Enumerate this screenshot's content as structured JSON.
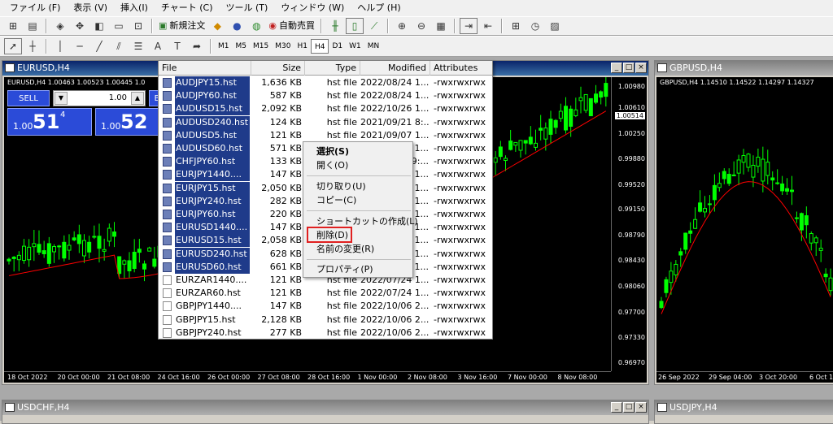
{
  "menu": [
    "ファイル (F)",
    "表示 (V)",
    "挿入(I)",
    "チャート (C)",
    "ツール (T)",
    "ウィンドウ (W)",
    "ヘルプ (H)"
  ],
  "toolbar": {
    "new_order": "新規注文",
    "auto_trading": "自動売買",
    "timeframes": [
      "M1",
      "M5",
      "M15",
      "M30",
      "H1",
      "H4",
      "D1",
      "W1",
      "MN"
    ],
    "active_timeframe": "H4"
  },
  "windows": {
    "eurusd": {
      "title": "EURUSD,H4",
      "info": "EURUSD,H4 1.00463 1.00523 1.00445 1.0",
      "sell_label": "SELL",
      "buy_label": "B",
      "lot": "1.00",
      "bid_small": "1.00",
      "bid_big": "51",
      "bid_sup": "4",
      "ask_small": "1.00",
      "ask_big": "52",
      "yaxis": [
        "1.00980",
        "1.00610",
        "1.00514",
        "1.00250",
        "0.99880",
        "0.99520",
        "0.99150",
        "0.98790",
        "0.98430",
        "0.98060",
        "0.97700",
        "0.97330",
        "0.96970"
      ],
      "current_price": "1.00514",
      "xaxis": [
        "18 Oct 2022",
        "20 Oct 00:00",
        "21 Oct 08:00",
        "24 Oct 16:00",
        "26 Oct 00:00",
        "27 Oct 08:00",
        "28 Oct 16:00",
        "1 Nov 00:00",
        "2 Nov 08:00",
        "3 Nov 16:00",
        "7 Nov 00:00",
        "8 Nov 08:00"
      ]
    },
    "gbpusd": {
      "title": "GBPUSD,H4",
      "info": "GBPUSD,H4 1.14510 1.14522 1.14297 1.14327",
      "xaxis": [
        "26 Sep 2022",
        "29 Sep 04:00",
        "3 Oct 20:00",
        "6 Oct 12"
      ]
    },
    "usdchf": {
      "title": "USDCHF,H4"
    },
    "usdjpy": {
      "title": "USDJPY,H4"
    }
  },
  "filelist": {
    "columns": [
      "File",
      "Size",
      "Type",
      "Modified",
      "Attributes"
    ],
    "rows": [
      {
        "name": "AUDJPY15.hst",
        "size": "1,636 KB",
        "type": "hst file",
        "modified": "2022/08/24 1...",
        "attr": "-rwxrwxrwx",
        "selected": true
      },
      {
        "name": "AUDJPY60.hst",
        "size": "587 KB",
        "type": "hst file",
        "modified": "2022/08/24 1...",
        "attr": "-rwxrwxrwx",
        "selected": true
      },
      {
        "name": "AUDUSD15.hst",
        "size": "2,092 KB",
        "type": "hst file",
        "modified": "2022/10/26 1...",
        "attr": "-rwxrwxrwx",
        "selected": true
      },
      {
        "name": "AUDUSD240.hst",
        "size": "124 KB",
        "type": "hst file",
        "modified": "2021/09/21 8:...",
        "attr": "-rwxrwxrwx",
        "selected": true
      },
      {
        "name": "AUDUSD5.hst",
        "size": "121 KB",
        "type": "hst file",
        "modified": "2021/09/07 1...",
        "attr": "-rwxrwxrwx",
        "selected": true
      },
      {
        "name": "AUDUSD60.hst",
        "size": "571 KB",
        "type": "hst",
        "modified": "4 1...",
        "attr": "-rwxrwxrwx",
        "selected": true
      },
      {
        "name": "CHFJPY60.hst",
        "size": "133 KB",
        "type": "hst",
        "modified": "9:...",
        "attr": "-rwxrwxrwx",
        "selected": true
      },
      {
        "name": "EURJPY1440....",
        "size": "147 KB",
        "type": "hst",
        "modified": "6 1...",
        "attr": "-rwxrwxrwx",
        "selected": true
      },
      {
        "name": "EURJPY15.hst",
        "size": "2,050 KB",
        "type": "hst",
        "modified": "5 1...",
        "attr": "-rwxrwxrwx",
        "selected": true
      },
      {
        "name": "EURJPY240.hst",
        "size": "282 KB",
        "type": "hst",
        "modified": "6 1...",
        "attr": "-rwxrwxrwx",
        "selected": true
      },
      {
        "name": "EURJPY60.hst",
        "size": "220 KB",
        "type": "hst",
        "modified": "5 1...",
        "attr": "-rwxrwxrwx",
        "selected": true
      },
      {
        "name": "EURUSD1440....",
        "size": "147 KB",
        "type": "hst",
        "modified": "7 1...",
        "attr": "-rwxrwxrwx",
        "selected": true
      },
      {
        "name": "EURUSD15.hst",
        "size": "2,058 KB",
        "type": "hst",
        "modified": "1...",
        "attr": "-rwxrwxrwx",
        "selected": true
      },
      {
        "name": "EURUSD240.hst",
        "size": "628 KB",
        "type": "hst",
        "modified": "6 1...",
        "attr": "-rwxrwxrwx",
        "selected": true
      },
      {
        "name": "EURUSD60.hst",
        "size": "661 KB",
        "type": "hst",
        "modified": "6 1...",
        "attr": "-rwxrwxrwx",
        "selected": true
      },
      {
        "name": "EURZAR1440....",
        "size": "121 KB",
        "type": "hst file",
        "modified": "2022/07/24 1...",
        "attr": "-rwxrwxrwx",
        "selected": false
      },
      {
        "name": "EURZAR60.hst",
        "size": "121 KB",
        "type": "hst file",
        "modified": "2022/07/24 1...",
        "attr": "-rwxrwxrwx",
        "selected": false
      },
      {
        "name": "GBPJPY1440....",
        "size": "147 KB",
        "type": "hst file",
        "modified": "2022/10/06 2...",
        "attr": "-rwxrwxrwx",
        "selected": false
      },
      {
        "name": "GBPJPY15.hst",
        "size": "2,128 KB",
        "type": "hst file",
        "modified": "2022/10/06 2...",
        "attr": "-rwxrwxrwx",
        "selected": false
      },
      {
        "name": "GBPJPY240.hst",
        "size": "277 KB",
        "type": "hst file",
        "modified": "2022/10/06 2...",
        "attr": "-rwxrwxrwx",
        "selected": false
      }
    ]
  },
  "context_menu": {
    "select": "選択(S)",
    "open": "開く(O)",
    "cut": "切り取り(U)",
    "copy": "コピー(C)",
    "shortcut": "ショートカットの作成(L)",
    "delete": "削除(D)",
    "rename": "名前の変更(R)",
    "properties": "プロパティ(P)"
  },
  "colors": {
    "chart_bg": "#000000",
    "candle": "#00ff00",
    "ma_line": "#ff0000",
    "selection": "#1f3b8a",
    "highlight_box": "#e02020",
    "title_active": "#0a246a"
  }
}
